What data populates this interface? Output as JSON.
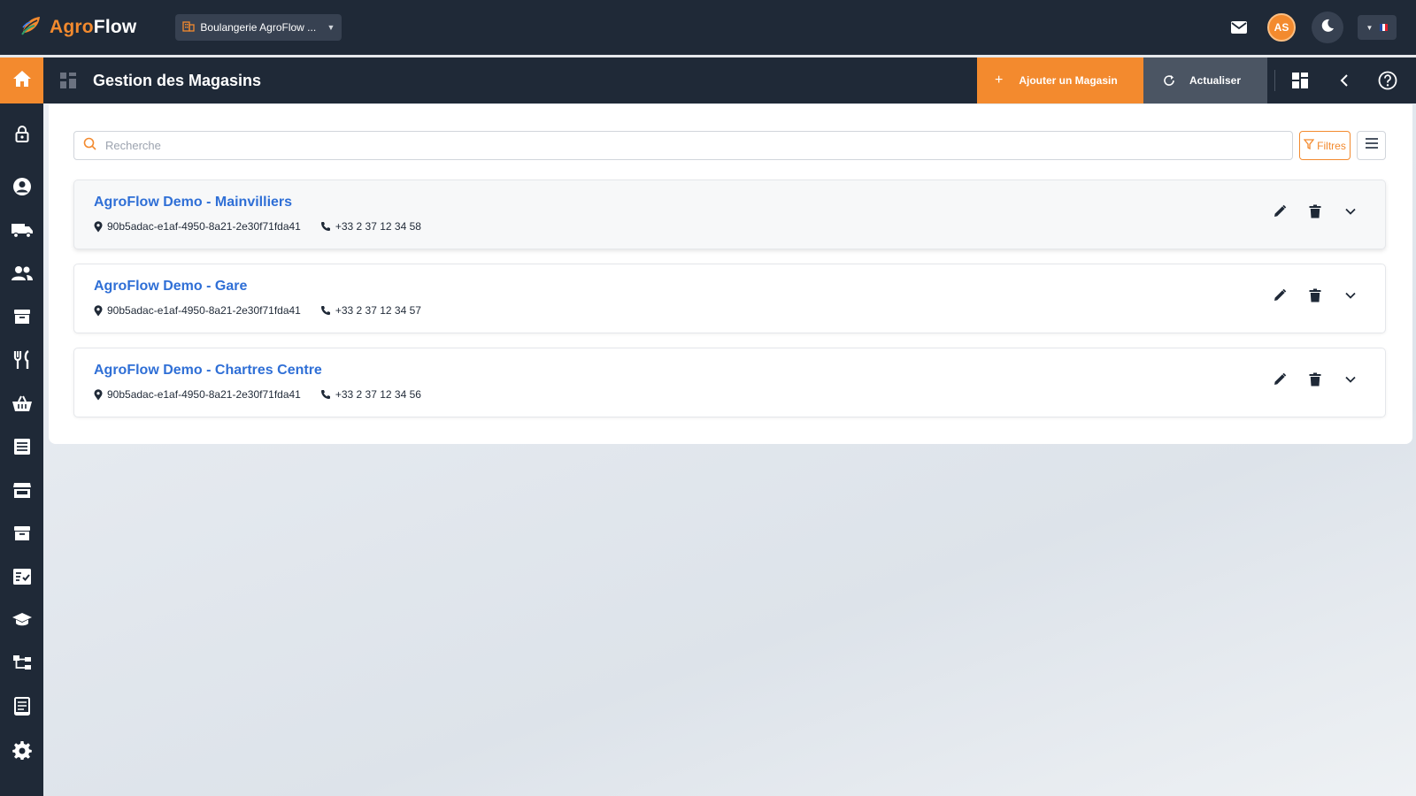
{
  "app": {
    "name_part1": "Agro",
    "name_part2": "Flow",
    "brand_color": "#f38a2e"
  },
  "topbar": {
    "company_selector": "Boulangerie AgroFlow ...",
    "user_initials": "AS",
    "icons": [
      "mail-icon",
      "moon-icon",
      "flag-fr-icon"
    ]
  },
  "sidebar": {
    "items": [
      {
        "icon": "home-icon"
      },
      {
        "icon": "lock-icon"
      },
      {
        "icon": "user-circle-icon"
      },
      {
        "icon": "truck-icon"
      },
      {
        "icon": "users-icon"
      },
      {
        "icon": "archive-icon"
      },
      {
        "icon": "utensils-icon"
      },
      {
        "icon": "basket-icon"
      },
      {
        "icon": "list-icon"
      },
      {
        "icon": "store-icon"
      },
      {
        "icon": "box-icon"
      },
      {
        "icon": "checklist-icon"
      },
      {
        "icon": "graduation-cap-icon"
      },
      {
        "icon": "hierarchy-icon"
      },
      {
        "icon": "document-icon"
      },
      {
        "icon": "gear-icon"
      }
    ]
  },
  "header": {
    "title": "Gestion des Magasins",
    "add_button": "Ajouter un Magasin",
    "refresh_button": "Actualiser"
  },
  "toolbar": {
    "search_placeholder": "Recherche",
    "search_value": "",
    "filter_label": "Filtres"
  },
  "stores": [
    {
      "name": "AgroFlow Demo - Mainvilliers",
      "address": "90b5adac-e1af-4950-8a21-2e30f71fda41",
      "phone": "+33 2 37 12 34 58"
    },
    {
      "name": "AgroFlow Demo - Gare",
      "address": "90b5adac-e1af-4950-8a21-2e30f71fda41",
      "phone": "+33 2 37 12 34 57"
    },
    {
      "name": "AgroFlow Demo - Chartres Centre",
      "address": "90b5adac-e1af-4950-8a21-2e30f71fda41",
      "phone": "+33 2 37 12 34 56"
    }
  ]
}
